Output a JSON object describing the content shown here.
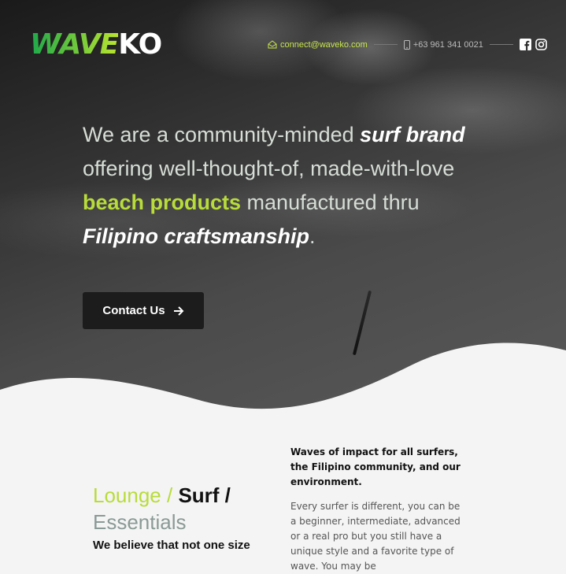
{
  "brand": {
    "logo_wave": "WAVE",
    "logo_ko": "KO"
  },
  "contact": {
    "email": "connect@waveko.com",
    "phone": "+63 961 341 0021"
  },
  "social": {
    "facebook_icon": "facebook-icon",
    "instagram_icon": "instagram-icon"
  },
  "hero": {
    "line_part1": "We are a community-minded ",
    "bold1": "surf",
    "bold2": "brand",
    "line_part2": " offering well-thought-of, made-with-love ",
    "highlight": "beach products",
    "line_part3": " manufactured thru ",
    "bold3": "Filipino craftsmanship",
    "end": ".",
    "cta_label": "Contact Us"
  },
  "section": {
    "cat1": "Lounge",
    "slash1": " / ",
    "cat2": "Surf",
    "slash2": " /",
    "cat3": "Essentials",
    "believe": "We believe that not one size",
    "impact": "Waves of impact for all surfers, the Filipino community, and our environment.",
    "paragraph": "Every surfer is different, you can be a beginner, intermediate, advanced or a real pro but you still have a unique style and a favorite type of wave. You may be"
  },
  "colors": {
    "accent": "#b8dc3a",
    "dark": "#1c1c1c"
  }
}
